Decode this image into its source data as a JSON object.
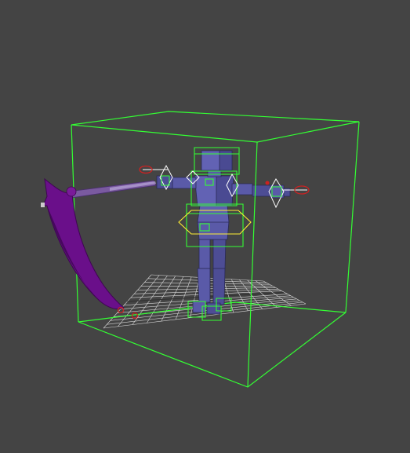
{
  "viewport": {
    "background_color": "#444444"
  },
  "colors": {
    "bounding_box": "#33ff33",
    "grid_line": "#d8d8d8",
    "grid_axis": "#333333",
    "character_body": "#5a5aa8",
    "character_body_dark": "#3d3d7a",
    "character_edge": "#2a2a55",
    "scythe_blade": "#6a0f8a",
    "scythe_blade_dark": "#3e0652",
    "scythe_shaft": "#8a6bb0",
    "control_yellow": "#ffee33",
    "control_white": "#ffffff",
    "control_red": "#cc2222"
  },
  "scene": {
    "objects": [
      {
        "name": "bounding-box-cube",
        "kind": "selection-box"
      },
      {
        "name": "grid-ground-plane",
        "kind": "home-grid"
      },
      {
        "name": "biped-character",
        "kind": "character-rig"
      },
      {
        "name": "scythe-prop",
        "kind": "mesh"
      },
      {
        "name": "hand-ik-controls",
        "kind": "rig-control"
      },
      {
        "name": "hip-control-ring",
        "kind": "rig-control"
      },
      {
        "name": "foot-controls",
        "kind": "rig-control"
      }
    ]
  }
}
